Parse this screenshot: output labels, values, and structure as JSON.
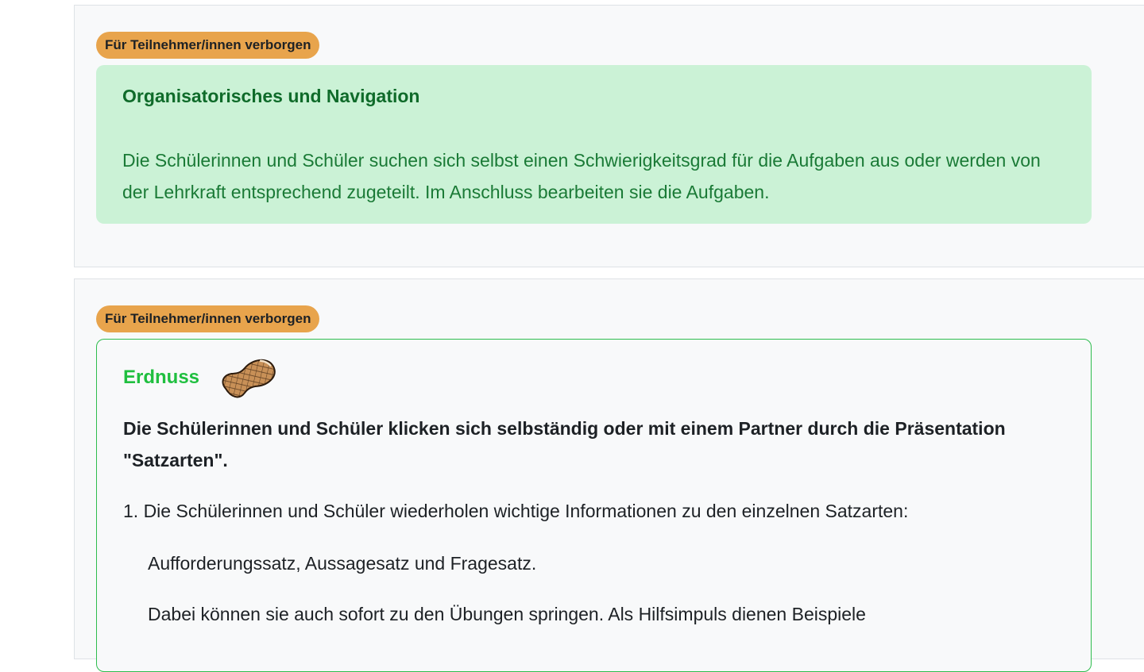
{
  "sections": [
    {
      "badge": "Für Teilnehmer/innen verborgen",
      "title": "Organisatorisches und Navigation",
      "text": "Die Schülerinnen und Schüler suchen sich selbst einen Schwierigkeitsgrad für die Aufgaben aus oder werden von der Lehrkraft entsprechend zugeteilt. Im Anschluss bearbeiten sie die Aufgaben."
    },
    {
      "badge": "Für Teilnehmer/innen verborgen",
      "level_title": "Erdnuss",
      "level_icon": "peanut-icon",
      "lead": "Die Schülerinnen und Schüler klicken sich selbständig oder mit einem Partner durch die Präsentation \"Satzarten\".",
      "step1": "1. Die Schülerinnen und Schüler wiederholen wichtige Informationen zu den einzelnen Satzarten:",
      "step1_detail": "Aufforderungssatz, Aussagesatz und Fragesatz.",
      "step1_more": "Dabei können sie  auch sofort zu den Übungen springen. Als Hilfsimpuls dienen Beispiele"
    }
  ],
  "colors": {
    "badge_bg": "#e8a44c",
    "green_box_bg": "#cbf2d6",
    "green_text": "#0f6b2a",
    "level_green": "#1fbf3f",
    "outline_border": "#2ebd4e"
  }
}
